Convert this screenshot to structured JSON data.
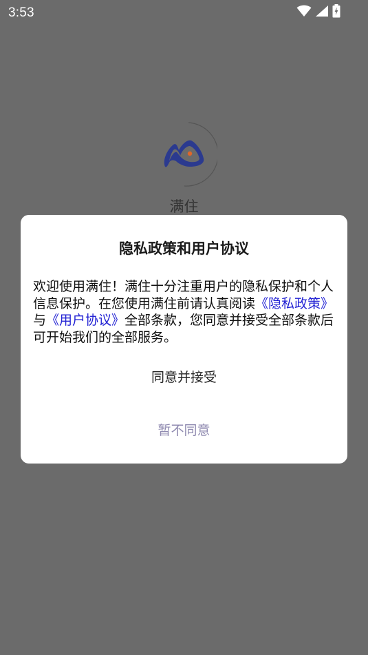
{
  "status_bar": {
    "time": "3:53",
    "icons": [
      "wifi-icon",
      "cellular-signal-icon",
      "battery-charging-icon"
    ]
  },
  "app": {
    "name": "满住",
    "logo_icon": "app-logo-icon",
    "logo_color": "#2b3a8f",
    "logo_dot_color": "#e0662a"
  },
  "dialog": {
    "title": "隐私政策和用户协议",
    "body": {
      "intro": "欢迎使用满住！满住十分注重用户的隐私保护和个人信息保护。在您使用满住前请认真阅读",
      "privacy_link": "《隐私政策》",
      "connector": "与",
      "agreement_link": "《用户协议》",
      "outro": "全部条款，您同意并接受全部条款后可开始我们的全部服务。"
    },
    "accept_label": "同意并接受",
    "decline_label": "暂不同意",
    "link_color": "#2323d4"
  }
}
